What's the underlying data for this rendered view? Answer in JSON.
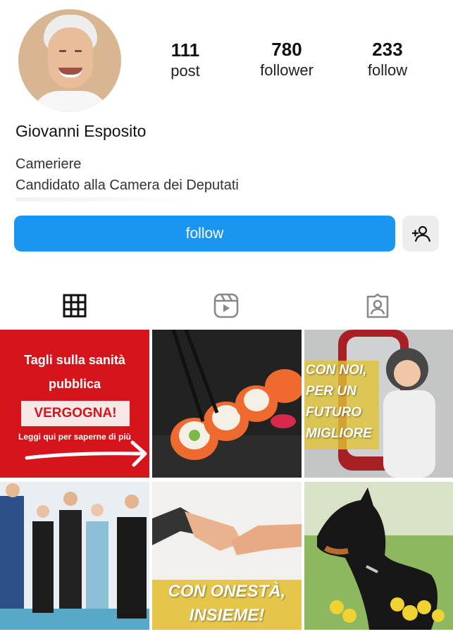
{
  "profile": {
    "name": "Giovanni Esposito",
    "bio_line1": "Cameriere",
    "bio_line2": "Candidato alla Camera dei Deputati"
  },
  "stats": [
    {
      "value": "111",
      "label": "post"
    },
    {
      "value": "780",
      "label": "follower"
    },
    {
      "value": "233",
      "label": "follow"
    }
  ],
  "actions": {
    "follow_label": "follow",
    "add_user_icon": "add-user-icon"
  },
  "tabs": [
    "grid-icon",
    "reels-icon",
    "tagged-icon"
  ],
  "posts": [
    {
      "title": "Tagli sulla sanità pubblica",
      "highlight": "VERGOGNA!",
      "cta": "Leggi qui per saperne di più"
    },
    {
      "image": "sushi"
    },
    {
      "text": "CON NOI, PER UN FUTURO MIGLIORE"
    },
    {
      "image": "business-team"
    },
    {
      "text": "CON ONESTÀ, INSIEME!"
    },
    {
      "image": "doberman-dog"
    }
  ],
  "colors": {
    "accent": "#1a96f0",
    "post_red": "#d5141c",
    "post_yellow": "#e5c64a"
  }
}
